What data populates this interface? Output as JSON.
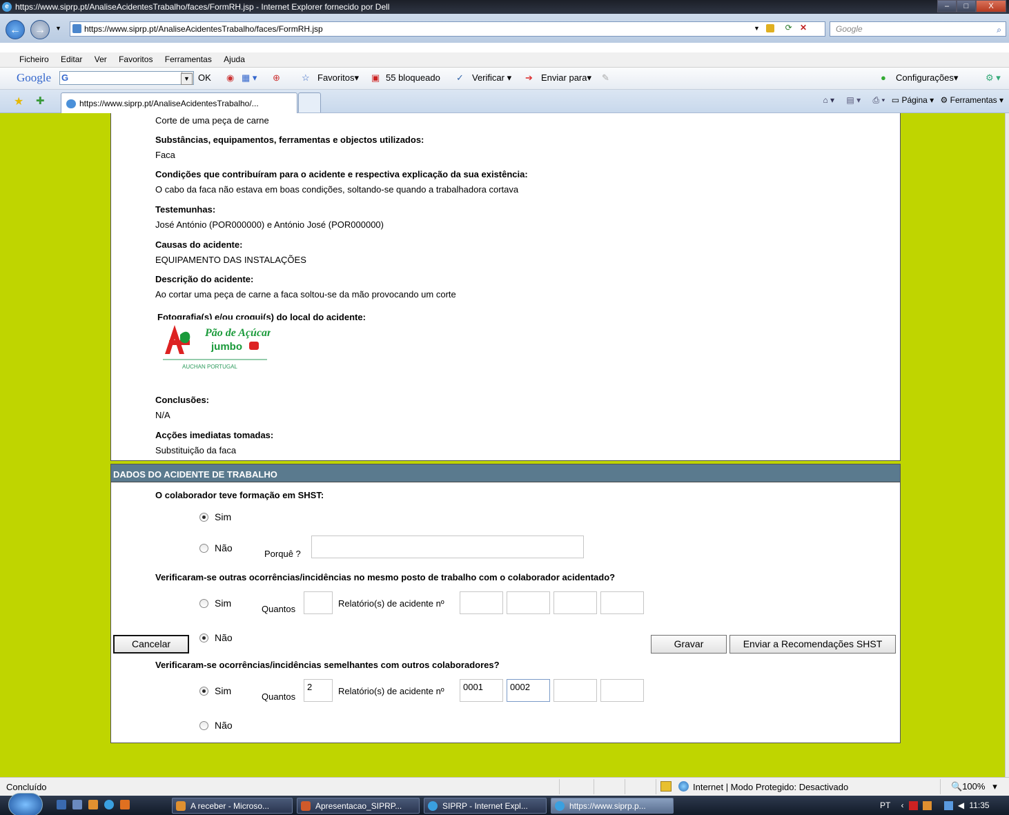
{
  "window": {
    "title": "https://www.siprp.pt/AnaliseAcidentesTrabalho/faces/FormRH.jsp - Internet Explorer fornecido por Dell",
    "min": "–",
    "max": "□",
    "close": "X"
  },
  "browser": {
    "address": "https://www.siprp.pt/AnaliseAcidentesTrabalho/faces/FormRH.jsp",
    "search_placeholder": "Google",
    "menu": [
      "Ficheiro",
      "Editar",
      "Ver",
      "Favoritos",
      "Ferramentas",
      "Ajuda"
    ],
    "gtoolbar": {
      "logo": "Google",
      "g": "G",
      "ok": "OK",
      "favoritos": "Favoritos",
      "bloqueado": "55 bloqueado",
      "verificar": "Verificar",
      "enviar": "Enviar para",
      "config": "Configurações"
    },
    "tab_title": "https://www.siprp.pt/AnaliseAcidentesTrabalho/...",
    "tab_tools": {
      "pagina": "Página",
      "ferramentas": "Ferramentas"
    }
  },
  "report": {
    "partial_top": "Corte de uma peça de carne",
    "fields": [
      {
        "label": "Substâncias, equipamentos, ferramentas e objectos utilizados:",
        "value": "Faca"
      },
      {
        "label": "Condições que contribuíram para o acidente e respectiva explicação da sua existência:",
        "value": "O cabo da faca não estava em boas condições, soltando-se quando a trabalhadora cortava"
      },
      {
        "label": "Testemunhas:",
        "value": "José António (POR000000) e António José (POR000000)"
      },
      {
        "label": "Causas do acidente:",
        "value": "EQUIPAMENTO DAS INSTALAÇÕES"
      },
      {
        "label": "Descrição do acidente:",
        "value": "Ao cortar uma peça de carne a faca soltou-se da mão provocando um corte"
      }
    ],
    "photo_label": "Fotografia(s) e/ou croqui(s) do local do acidente:",
    "logo": {
      "line1": "Pão de Açúcar",
      "line2": "jumbo",
      "line3": "AUCHAN PORTUGAL"
    },
    "conclusoes_label": "Conclusões:",
    "conclusoes_value": "N/A",
    "accoes_label": "Acções imediatas tomadas:",
    "accoes_value": "Substituição da faca"
  },
  "dados": {
    "header": "DADOS DO ACIDENTE DE TRABALHO",
    "q1": "O colaborador teve formação em SHST:",
    "sim": "Sim",
    "nao": "Não",
    "porque": "Porquê ?",
    "porque_value": "",
    "q2": "Verificaram-se outras ocorrências/incidências no mesmo posto de trabalho com o colaborador acidentado?",
    "quantos": "Quantos",
    "relatorio": "Relatório(s) de acidente nº",
    "q2_quantos": "",
    "q2_relatorios": [
      "",
      "",
      "",
      ""
    ],
    "q3": "Verificaram-se ocorrências/incidências semelhantes com outros colaboradores?",
    "q3_quantos": "2",
    "q3_relatorios": [
      "0001",
      "0002",
      "",
      ""
    ]
  },
  "buttons": {
    "cancelar": "Cancelar",
    "gravar": "Gravar",
    "enviar": "Enviar a Recomendações SHST"
  },
  "statusbar": {
    "text": "Concluído",
    "zone": "Internet | Modo Protegido: Desactivado",
    "zoom": "100%"
  },
  "taskbar": {
    "items": [
      "A receber - Microso...",
      "Apresentacao_SIPRP...",
      "SIPRP - Internet Expl...",
      "https://www.siprp.p..."
    ],
    "lang": "PT",
    "time": "11:35"
  }
}
